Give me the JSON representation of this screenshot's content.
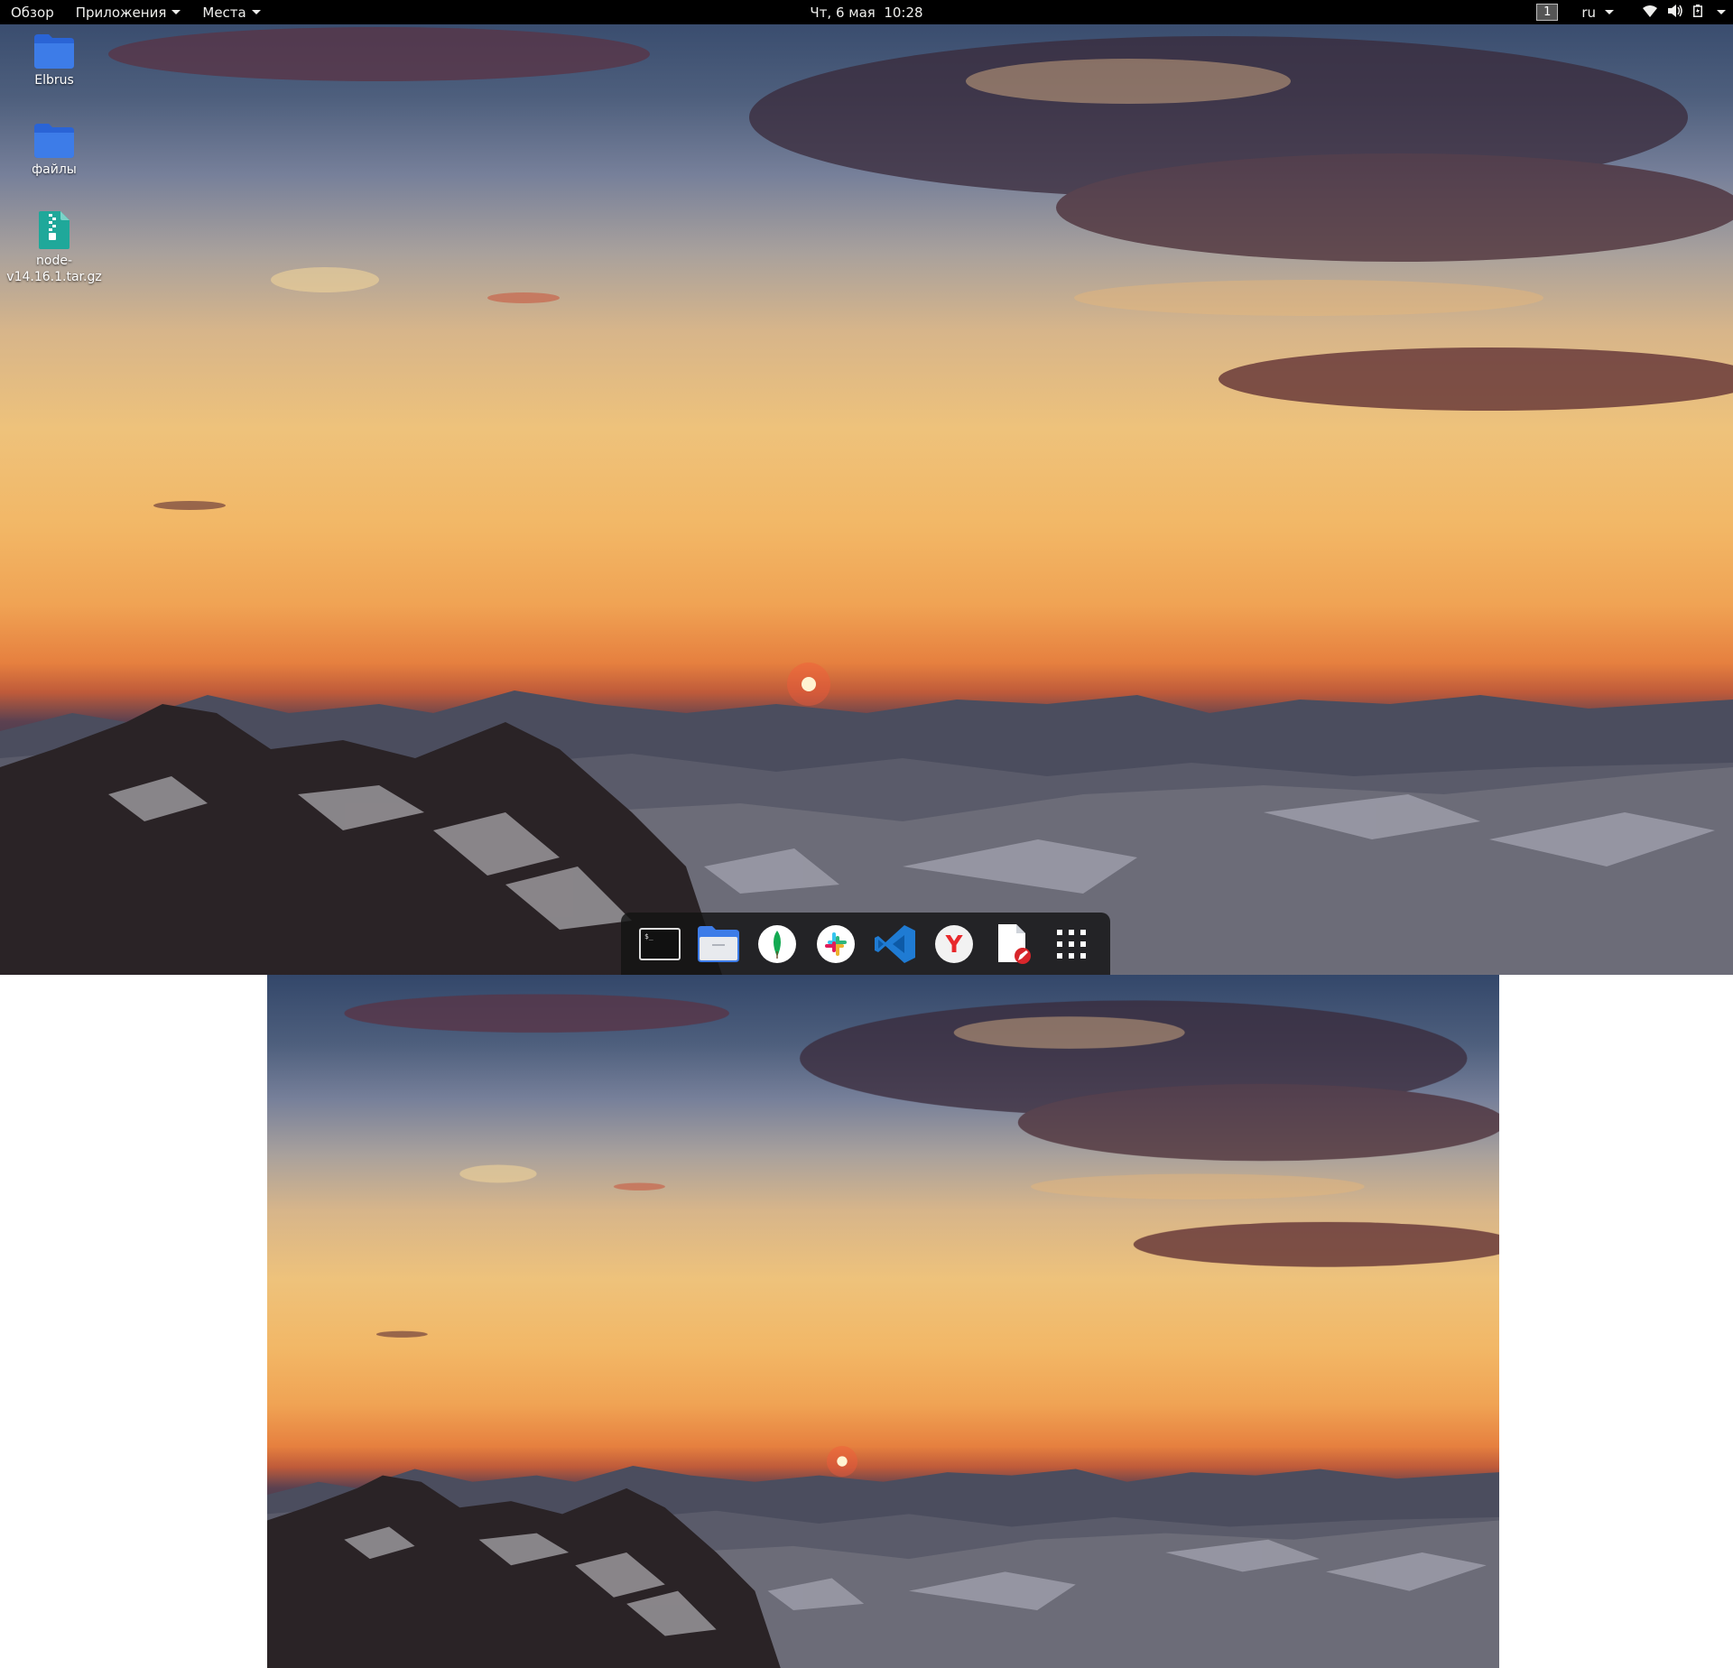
{
  "topbar": {
    "overview": "Обзор",
    "applications": "Приложения",
    "places": "Места",
    "clock": "Чт, 6 мая  10:28",
    "workspace": "1",
    "language": "ru"
  },
  "desktop_icons": [
    {
      "label": "Elbrus",
      "icon": "folder-icon"
    },
    {
      "label": "файлы",
      "icon": "folder-icon"
    },
    {
      "label_line1": "node-",
      "label_line2": "v14.16.1.tar.gz",
      "icon": "archive-icon"
    }
  ],
  "dock": {
    "apps": [
      "terminal",
      "files",
      "mongodb-compass",
      "slack",
      "visual-studio-code",
      "yandex-browser",
      "text-editor",
      "show-applications"
    ]
  },
  "colors": {
    "topbar_bg": "#000000",
    "folder_blue": "#3d7ce8",
    "archive_teal": "#1fa89a",
    "vscode_blue": "#1f7bd3",
    "yandex_red": "#e8282b"
  }
}
